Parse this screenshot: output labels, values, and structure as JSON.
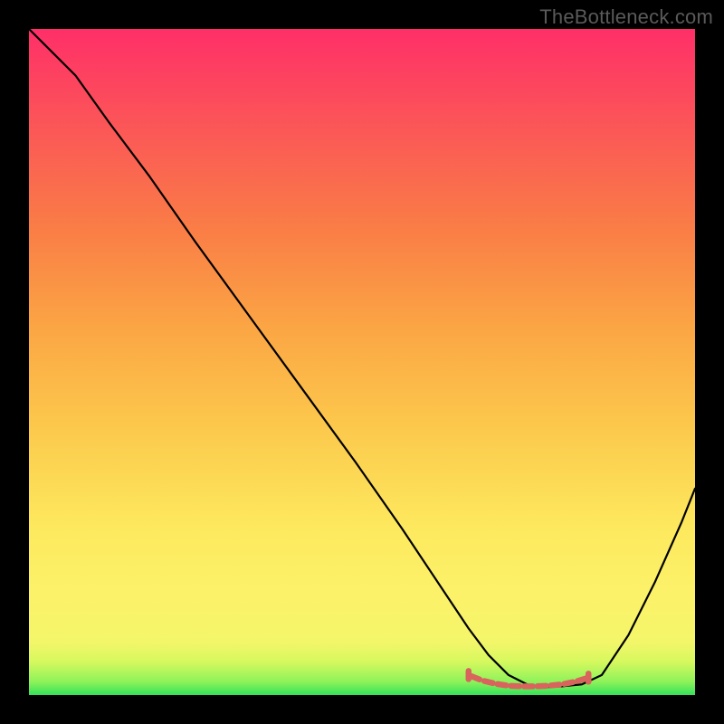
{
  "watermark": "TheBottleneck.com",
  "chart_data": {
    "type": "line",
    "title": "",
    "xlabel": "",
    "ylabel": "",
    "xrange": [
      0,
      100
    ],
    "yrange": [
      0,
      100
    ],
    "grid": false,
    "legend": false,
    "background": {
      "note": "vertical gradient mapped to y",
      "stops": [
        {
          "y": 0,
          "color": "#34e25a"
        },
        {
          "y": 2,
          "color": "#8ef25a"
        },
        {
          "y": 5,
          "color": "#d6f85e"
        },
        {
          "y": 8,
          "color": "#f4f66a"
        },
        {
          "y": 15,
          "color": "#fcf26a"
        },
        {
          "y": 25,
          "color": "#fde95e"
        },
        {
          "y": 40,
          "color": "#fcc94c"
        },
        {
          "y": 55,
          "color": "#fba644"
        },
        {
          "y": 70,
          "color": "#fa7d46"
        },
        {
          "y": 85,
          "color": "#fb5757"
        },
        {
          "y": 100,
          "color": "#ff2f68"
        }
      ]
    },
    "series": [
      {
        "name": "curve",
        "stroke": "#000000",
        "stroke_width": 2.2,
        "x": [
          0,
          3,
          7,
          12,
          18,
          25,
          33,
          41,
          49,
          56,
          62,
          66,
          69,
          72,
          75,
          78,
          80,
          83,
          86,
          90,
          94,
          98,
          100
        ],
        "y": [
          100,
          97,
          93,
          86,
          78,
          68,
          57,
          46,
          35,
          25,
          16,
          10,
          6,
          3,
          1.5,
          1.2,
          1.3,
          1.6,
          3,
          9,
          17,
          26,
          31
        ]
      },
      {
        "name": "highlight-segment",
        "stroke": "#d9635d",
        "stroke_width": 6.5,
        "x": [
          66,
          68,
          70,
          72,
          74,
          76,
          78,
          80,
          82,
          84
        ],
        "y": [
          3.0,
          2.2,
          1.7,
          1.4,
          1.3,
          1.3,
          1.4,
          1.6,
          2.0,
          2.6
        ]
      }
    ]
  }
}
